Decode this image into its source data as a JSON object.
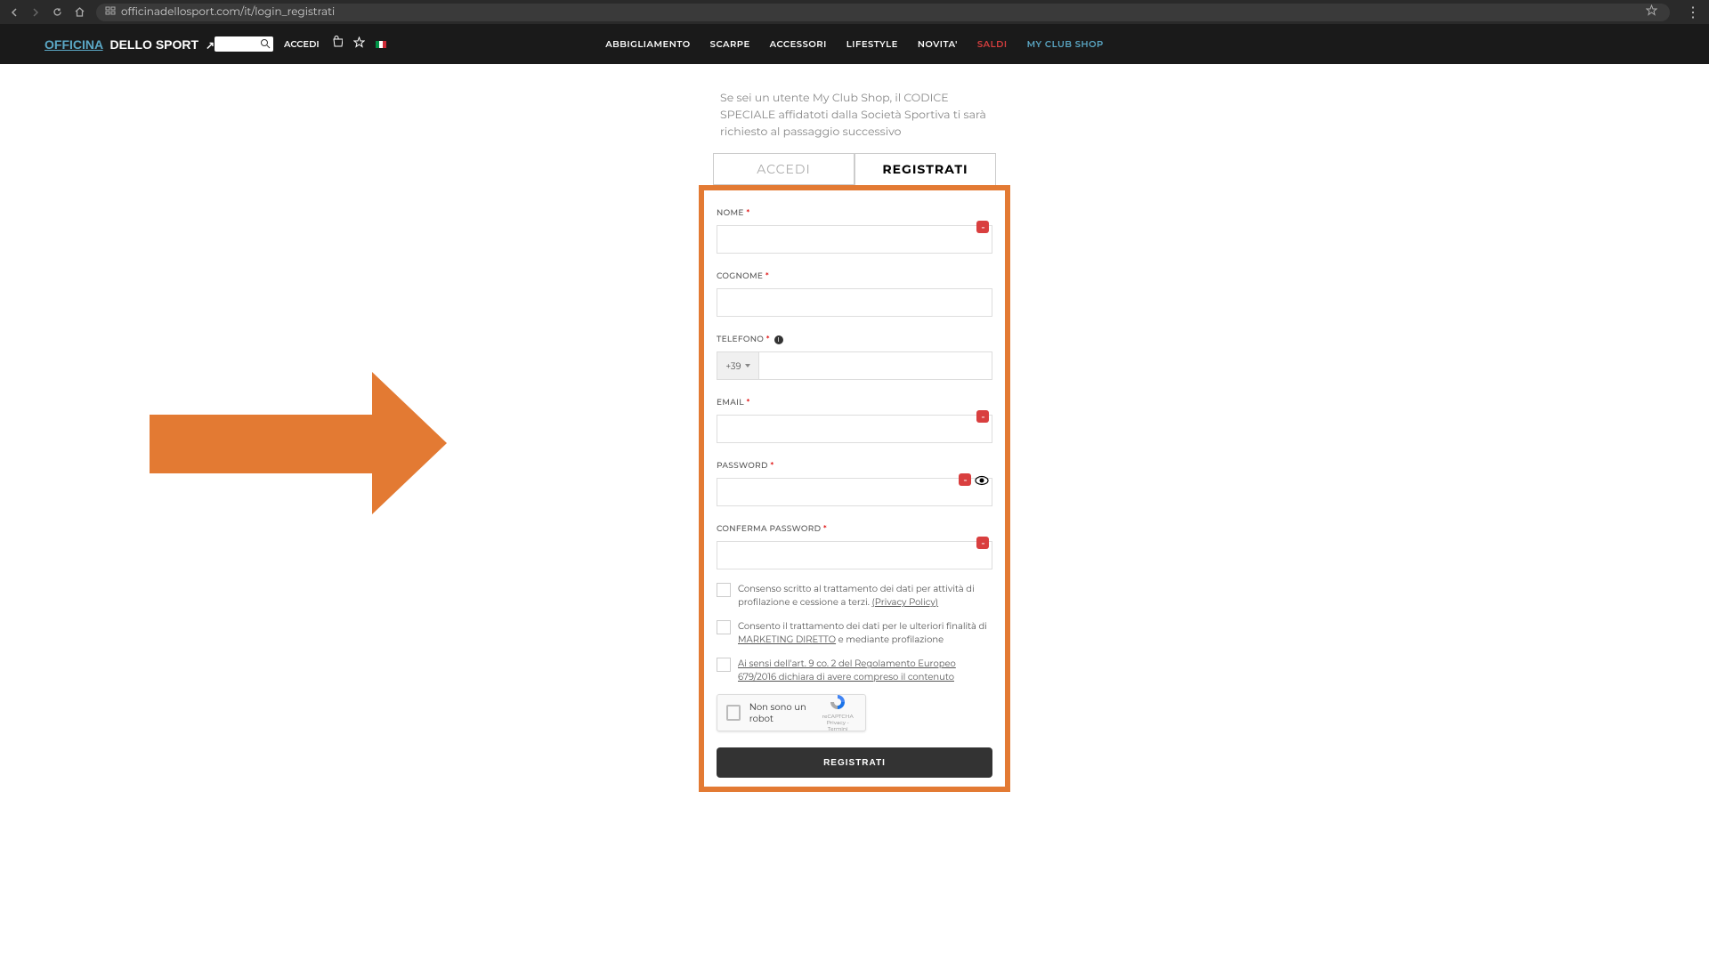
{
  "browser": {
    "url": "officinadellosport.com/it/login_registrati"
  },
  "header": {
    "logo": {
      "officina": "OFFICINA",
      "dello": "DELLO SPORT"
    },
    "nav": [
      "ABBIGLIAMENTO",
      "SCARPE",
      "ACCESSORI",
      "LIFESTYLE",
      "NOVITA'",
      "SALDI",
      "MY CLUB SHOP"
    ],
    "accedi": "ACCEDI"
  },
  "intro": "Se sei un utente My Club Shop, il CODICE SPECIALE affidatoti dalla Società Sportiva ti sarà richiesto al passaggio successivo",
  "tabs": {
    "login": "ACCEDI",
    "register": "REGISTRATI"
  },
  "form": {
    "nome": "NOME",
    "cognome": "COGNOME",
    "telefono": "TELEFONO",
    "phone_prefix": "+39",
    "email": "EMAIL",
    "password": "PASSWORD",
    "conferma_password": "CONFERMA PASSWORD",
    "consent1_a": "Consenso scritto al trattamento dei dati per attività di profilazione e cessione a terzi. ",
    "consent1_link": "(Privacy Policy)",
    "consent2_a": "Consento il trattamento dei dati per le ulteriori finalità di ",
    "consent2_link": "MARKETING DIRETTO",
    "consent2_b": " e mediante profilazione",
    "consent3_link": "Ai sensi dell'art. 9 co. 2 del Regolamento Europeo 679/2016 dichiara di avere compreso il contenuto",
    "recaptcha": "Non sono un robot",
    "recaptcha_brand": "reCAPTCHA",
    "recaptcha_legal": "Privacy - Termini",
    "submit": "REGISTRATI"
  }
}
